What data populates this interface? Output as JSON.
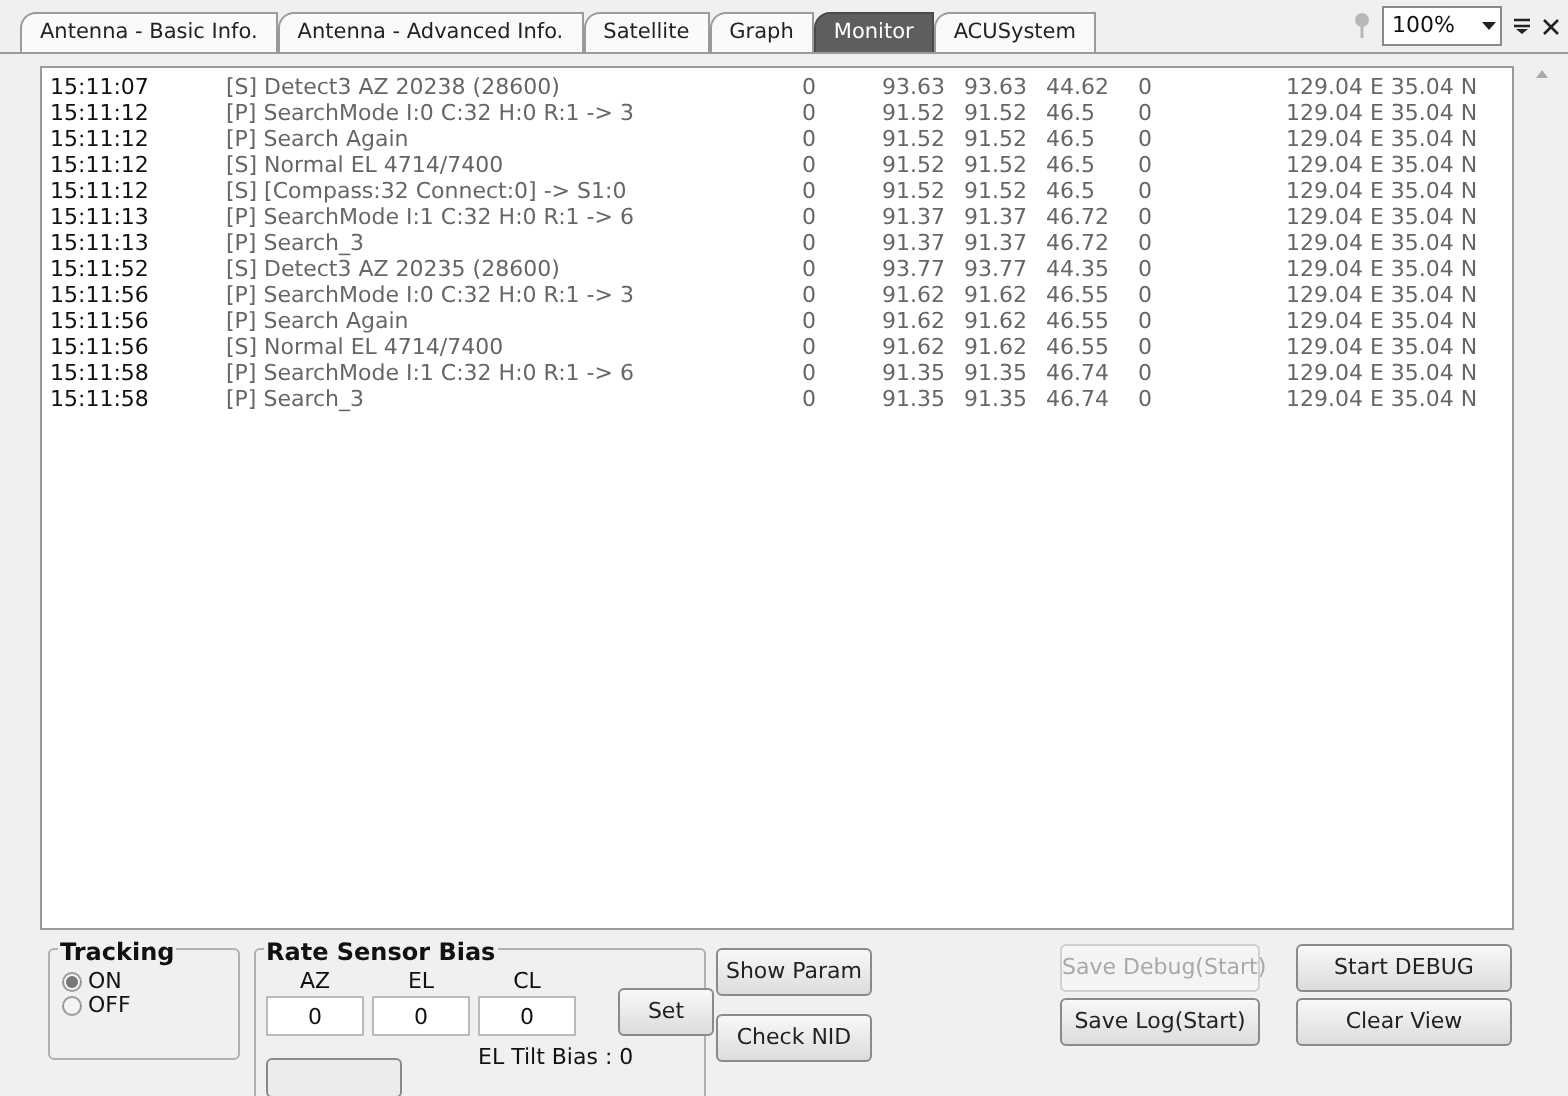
{
  "tabs": [
    {
      "label": "Antenna - Basic Info.",
      "selected": false
    },
    {
      "label": "Antenna - Advanced Info.",
      "selected": false
    },
    {
      "label": "Satellite",
      "selected": false
    },
    {
      "label": "Graph",
      "selected": false
    },
    {
      "label": "Monitor",
      "selected": true
    },
    {
      "label": "ACUSystem",
      "selected": false
    }
  ],
  "zoom": {
    "value": "100%"
  },
  "log": {
    "rows": [
      {
        "time": "15:11:07",
        "message": "[S] Detect3 AZ 20238 (28600)",
        "values": [
          "0",
          "93.63",
          "93.63",
          "44.62",
          "0",
          "129.04 E 35.04 N"
        ]
      },
      {
        "time": "15:11:12",
        "message": "[P] SearchMode I:0 C:32 H:0 R:1 -> 3",
        "values": [
          "0",
          "91.52",
          "91.52",
          "46.5",
          "0",
          "129.04 E 35.04 N"
        ]
      },
      {
        "time": "15:11:12",
        "message": "[P] Search Again",
        "values": [
          "0",
          "91.52",
          "91.52",
          "46.5",
          "0",
          "129.04 E 35.04 N"
        ]
      },
      {
        "time": "15:11:12",
        "message": "[S] Normal EL 4714/7400",
        "values": [
          "0",
          "91.52",
          "91.52",
          "46.5",
          "0",
          "129.04 E 35.04 N"
        ]
      },
      {
        "time": "15:11:12",
        "message": "[S] [Compass:32 Connect:0] -> S1:0",
        "values": [
          "0",
          "91.52",
          "91.52",
          "46.5",
          "0",
          "129.04 E 35.04 N"
        ]
      },
      {
        "time": "15:11:13",
        "message": "[P] SearchMode I:1 C:32 H:0 R:1 -> 6",
        "values": [
          "0",
          "91.37",
          "91.37",
          "46.72",
          "0",
          "129.04 E 35.04 N"
        ]
      },
      {
        "time": "15:11:13",
        "message": "[P] Search_3",
        "values": [
          "0",
          "91.37",
          "91.37",
          "46.72",
          "0",
          "129.04 E 35.04 N"
        ]
      },
      {
        "time": "15:11:52",
        "message": "[S] Detect3 AZ 20235 (28600)",
        "values": [
          "0",
          "93.77",
          "93.77",
          "44.35",
          "0",
          "129.04 E 35.04 N"
        ]
      },
      {
        "time": "15:11:56",
        "message": "[P] SearchMode I:0 C:32 H:0 R:1 -> 3",
        "values": [
          "0",
          "91.62",
          "91.62",
          "46.55",
          "0",
          "129.04 E 35.04 N"
        ]
      },
      {
        "time": "15:11:56",
        "message": "[P] Search Again",
        "values": [
          "0",
          "91.62",
          "91.62",
          "46.55",
          "0",
          "129.04 E 35.04 N"
        ]
      },
      {
        "time": "15:11:56",
        "message": "[S] Normal EL 4714/7400",
        "values": [
          "0",
          "91.62",
          "91.62",
          "46.55",
          "0",
          "129.04 E 35.04 N"
        ]
      },
      {
        "time": "15:11:58",
        "message": "[P] SearchMode I:1 C:32 H:0 R:1 -> 6",
        "values": [
          "0",
          "91.35",
          "91.35",
          "46.74",
          "0",
          "129.04 E 35.04 N"
        ]
      },
      {
        "time": "15:11:58",
        "message": "[P] Search_3",
        "values": [
          "0",
          "91.35",
          "91.35",
          "46.74",
          "0",
          "129.04 E 35.04 N"
        ]
      }
    ]
  },
  "tracking": {
    "title": "Tracking",
    "options": [
      {
        "label": "ON",
        "selected": true
      },
      {
        "label": "OFF",
        "selected": false
      }
    ]
  },
  "rate_sensor_bias": {
    "title": "Rate Sensor Bias",
    "fields": [
      {
        "label": "AZ",
        "value": "0"
      },
      {
        "label": "EL",
        "value": "0"
      },
      {
        "label": "CL",
        "value": "0"
      }
    ],
    "set_button": "Set",
    "el_tilt_bias": "EL Tilt Bias : 0"
  },
  "param_buttons": [
    "Show Param",
    "Check NID"
  ],
  "debug_buttons": [
    {
      "label": "Save Debug(Start)",
      "disabled": true
    },
    {
      "label": "Start DEBUG",
      "disabled": false
    },
    {
      "label": "Save Log(Start)",
      "disabled": false
    },
    {
      "label": "Clear View",
      "disabled": false
    }
  ]
}
